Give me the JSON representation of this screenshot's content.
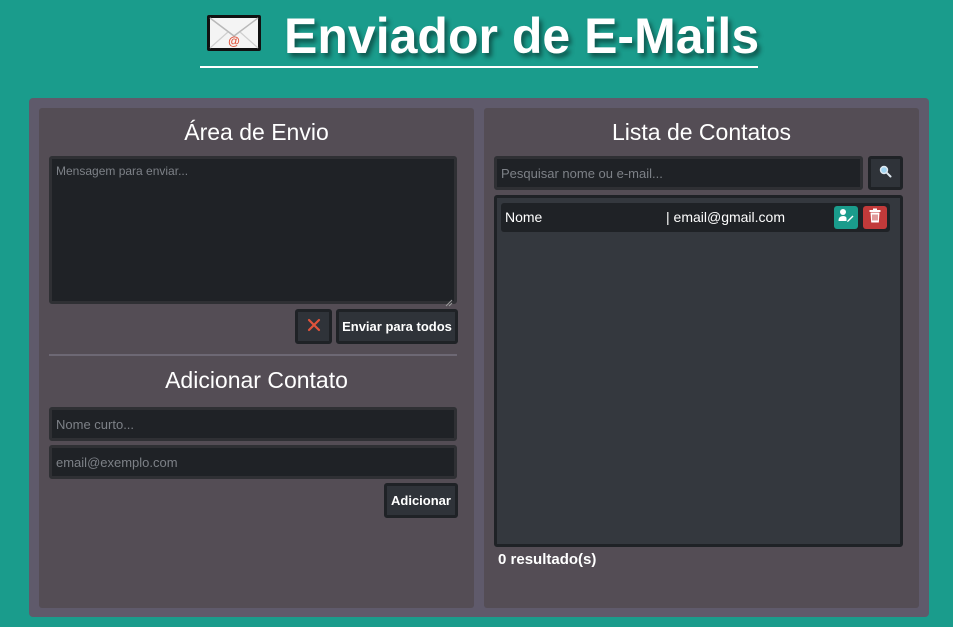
{
  "header": {
    "title": "Enviador de E-Mails",
    "icon": "envelope-icon"
  },
  "send_area": {
    "title": "Área de Envio",
    "message_placeholder": "Mensagem para enviar...",
    "message_value": "",
    "clear_icon": "x-icon",
    "send_all_label": "Enviar para todos"
  },
  "add_contact": {
    "title": "Adicionar Contato",
    "name_placeholder": "Nome curto...",
    "email_placeholder": "email@exemplo.com",
    "add_label": "Adicionar"
  },
  "contacts": {
    "title": "Lista de Contatos",
    "search_placeholder": "Pesquisar nome ou e-mail...",
    "search_icon": "magnifier-icon",
    "items": [
      {
        "name": "Nome",
        "email": "| email@gmail.com",
        "edit_icon": "edit-contact-icon",
        "delete_icon": "trash-icon"
      }
    ],
    "results_text": "0 resultado(s)"
  },
  "colors": {
    "background": "#1a9c8c",
    "outer_panel": "#5f5a6b",
    "panel": "#544d55",
    "input_bg": "#1f2226",
    "edit_button": "#1a9c8c",
    "delete_button": "#c23a3a"
  }
}
